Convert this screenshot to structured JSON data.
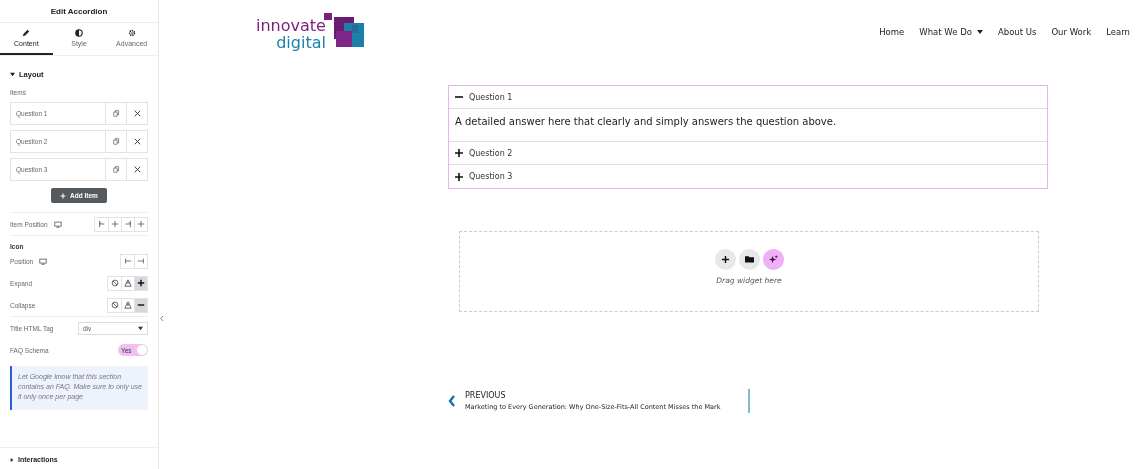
{
  "panel": {
    "title": "Edit Accordion",
    "tabs": [
      {
        "label": "Content",
        "kind": "pencil",
        "selected": true
      },
      {
        "label": "Style",
        "kind": "contrast",
        "selected": false
      },
      {
        "label": "Advanced",
        "kind": "gear",
        "selected": false
      }
    ],
    "layout_section": {
      "title": "Layout",
      "expanded": true
    },
    "items_label": "Items",
    "items": [
      {
        "label": "Question 1"
      },
      {
        "label": "Question 2"
      },
      {
        "label": "Question 3"
      }
    ],
    "add_button": "Add Item",
    "item_position": {
      "label": "Item Position",
      "choices": [
        {
          "kind": "start",
          "selected": false
        },
        {
          "kind": "center",
          "selected": false
        },
        {
          "kind": "end",
          "selected": false
        },
        {
          "kind": "stretch",
          "selected": false
        }
      ]
    },
    "icon_heading": "Icon",
    "icon_position": {
      "label": "Position",
      "choices": [
        {
          "kind": "start",
          "selected": false
        },
        {
          "kind": "end",
          "selected": false
        }
      ]
    },
    "expand": {
      "label": "Expand",
      "choices": [
        {
          "kind": "none",
          "selected": false
        },
        {
          "kind": "upload",
          "selected": false
        },
        {
          "kind": "plus",
          "selected": true
        }
      ]
    },
    "collapse": {
      "label": "Collapse",
      "choices": [
        {
          "kind": "none",
          "selected": false
        },
        {
          "kind": "upload",
          "selected": false
        },
        {
          "kind": "minus",
          "selected": true
        }
      ]
    },
    "title_tag": {
      "label": "Title HTML Tag",
      "value": "div"
    },
    "faq_schema": {
      "label": "FAQ Schema",
      "on": true,
      "text": "Yes"
    },
    "note": "Let Google know that this section contains an FAQ. Make sure to only use it only once per page",
    "interactions_section": {
      "title": "Interactions",
      "expanded": false
    }
  },
  "site": {
    "logo": {
      "line1": "innovate",
      "line2": "digital"
    },
    "nav": [
      {
        "label": "Home",
        "dropdown": false
      },
      {
        "label": "What We Do",
        "dropdown": true
      },
      {
        "label": "About Us",
        "dropdown": false
      },
      {
        "label": "Our Work",
        "dropdown": false
      },
      {
        "label": "Learn",
        "dropdown": false
      }
    ],
    "accordion": [
      {
        "title": "Question 1",
        "expanded": true,
        "answer": "A detailed answer here that clearly and simply answers the question above."
      },
      {
        "title": "Question 2",
        "expanded": false
      },
      {
        "title": "Question 3",
        "expanded": false
      }
    ],
    "drop_hint": "Drag widget here",
    "previous": {
      "label": "PREVIOUS",
      "title": "Marketing to Every Generation: Why One-Size-Fits-All Content Misses the Mark"
    }
  }
}
